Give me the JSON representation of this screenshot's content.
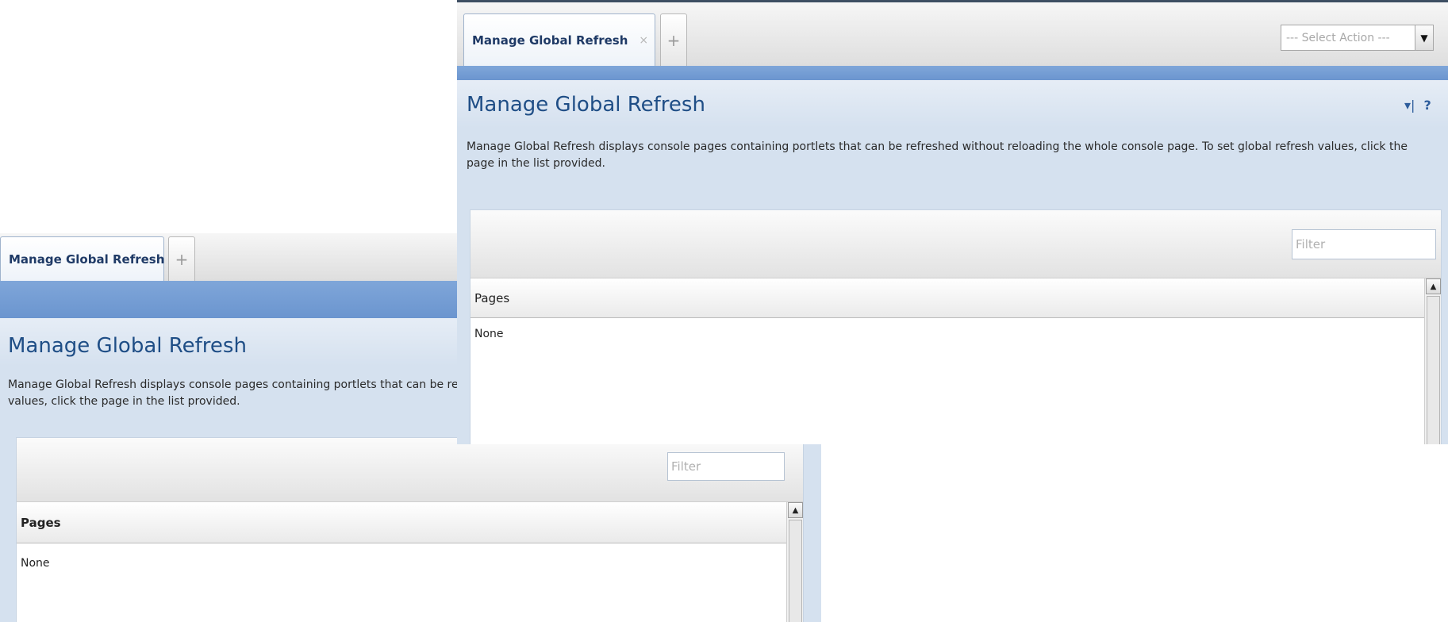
{
  "tab": {
    "label": "Manage Global Refresh",
    "close_glyph": "×",
    "add_glyph": "+"
  },
  "action_select": {
    "value": "--- Select Action ---",
    "arrow_glyph": "▼"
  },
  "page": {
    "title": "Manage Global Refresh",
    "description_full": "Manage Global Refresh displays console pages containing portlets that can be refreshed without reloading the whole console page. To set global refresh values, click the page in the list provided.",
    "description_clipped_line1": "Manage Global Refresh displays console pages containing portlets that can be refreshed",
    "description_clipped_line2": "values, click the page in the list provided.",
    "minimize_glyph": "▾|",
    "help_glyph": "?"
  },
  "filter": {
    "placeholder": "Filter"
  },
  "table": {
    "column_header": "Pages",
    "rows": [
      "None"
    ]
  },
  "scrollbar": {
    "up_glyph": "▲"
  }
}
